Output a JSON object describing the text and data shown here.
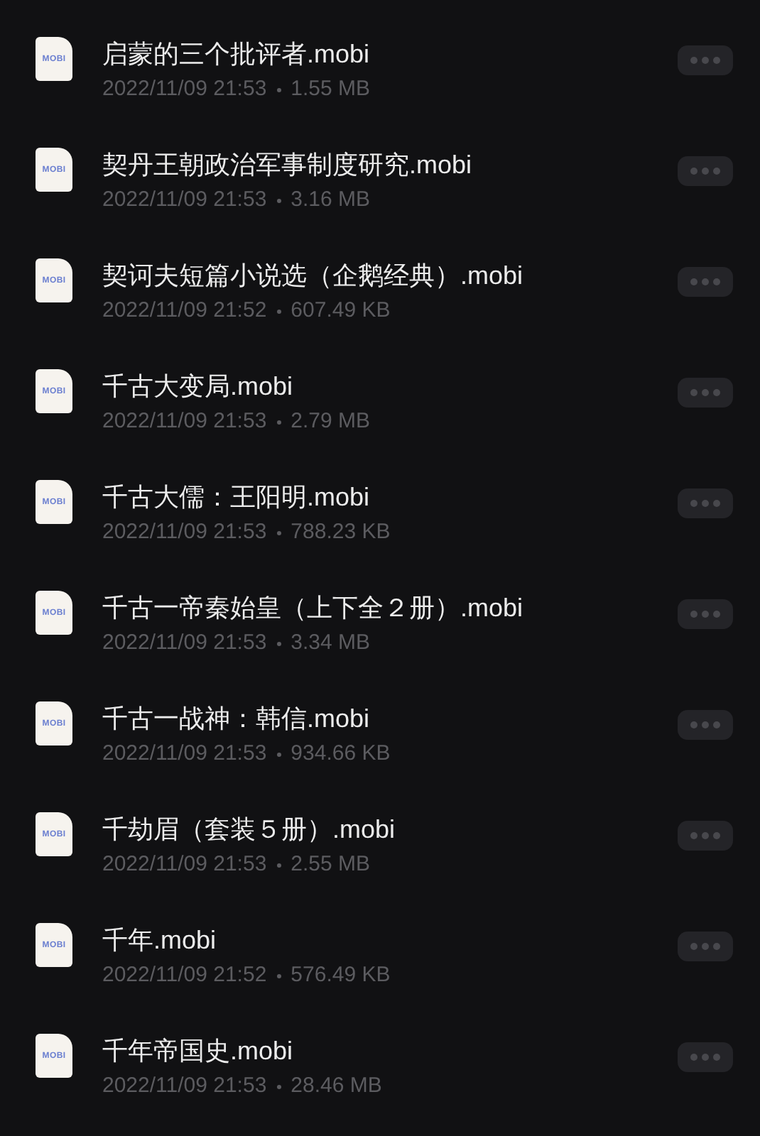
{
  "files": [
    {
      "icon_label": "MOBI",
      "name": "启蒙的三个批评者.mobi",
      "date": "2022/11/09 21:53",
      "size": "1.55 MB"
    },
    {
      "icon_label": "MOBI",
      "name": "契丹王朝政治军事制度研究.mobi",
      "date": "2022/11/09 21:53",
      "size": "3.16 MB"
    },
    {
      "icon_label": "MOBI",
      "name": "契诃夫短篇小说选（企鹅经典）.mobi",
      "date": "2022/11/09 21:52",
      "size": "607.49 KB"
    },
    {
      "icon_label": "MOBI",
      "name": "千古大变局.mobi",
      "date": "2022/11/09 21:53",
      "size": "2.79 MB"
    },
    {
      "icon_label": "MOBI",
      "name": "千古大儒：王阳明.mobi",
      "date": "2022/11/09 21:53",
      "size": "788.23 KB"
    },
    {
      "icon_label": "MOBI",
      "name": "千古一帝秦始皇（上下全２册）.mobi",
      "date": "2022/11/09 21:53",
      "size": "3.34 MB"
    },
    {
      "icon_label": "MOBI",
      "name": "千古一战神：韩信.mobi",
      "date": "2022/11/09 21:53",
      "size": "934.66 KB"
    },
    {
      "icon_label": "MOBI",
      "name": "千劫眉（套装５册）.mobi",
      "date": "2022/11/09 21:53",
      "size": "2.55 MB"
    },
    {
      "icon_label": "MOBI",
      "name": "千年.mobi",
      "date": "2022/11/09 21:52",
      "size": "576.49 KB"
    },
    {
      "icon_label": "MOBI",
      "name": "千年帝国史.mobi",
      "date": "2022/11/09 21:53",
      "size": "28.46 MB"
    }
  ]
}
